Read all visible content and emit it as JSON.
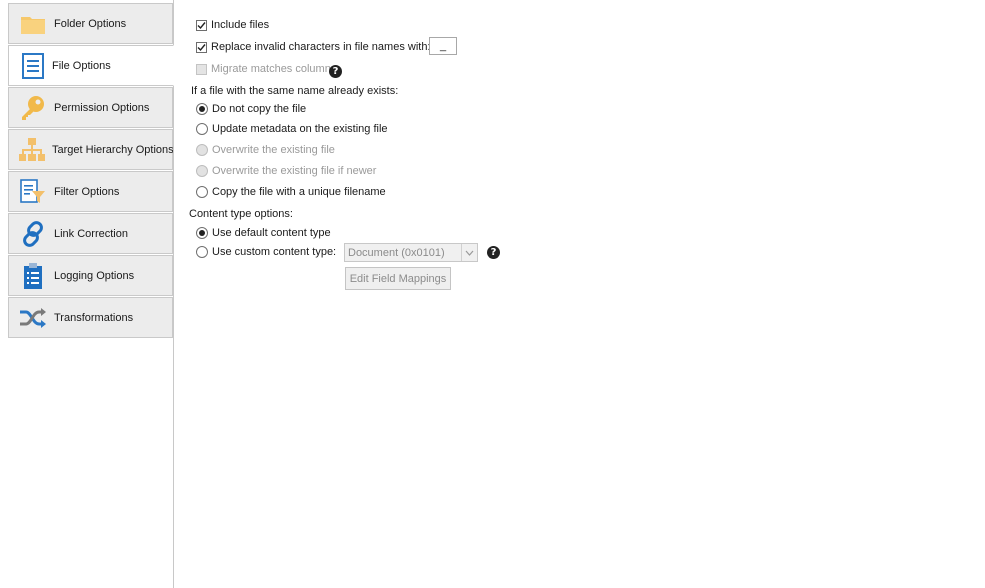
{
  "sidebar": {
    "items": [
      {
        "label": "Folder Options",
        "icon": "folder-icon"
      },
      {
        "label": "File Options",
        "icon": "file-document-icon"
      },
      {
        "label": "Permission Options",
        "icon": "key-icon"
      },
      {
        "label": "Target Hierarchy Options",
        "icon": "hierarchy-icon"
      },
      {
        "label": "Filter Options",
        "icon": "filter-icon"
      },
      {
        "label": "Link Correction",
        "icon": "link-icon"
      },
      {
        "label": "Logging Options",
        "icon": "clipboard-icon"
      },
      {
        "label": "Transformations",
        "icon": "shuffle-icon"
      }
    ],
    "active_index": 1
  },
  "file_options": {
    "include_files": {
      "label": "Include files",
      "checked": true
    },
    "replace_invalid": {
      "label": "Replace invalid characters in file names with:",
      "checked": true,
      "value": "_"
    },
    "migrate_matches": {
      "label": "Migrate matches column",
      "checked": false,
      "enabled": false
    },
    "exists_heading": "If a file with the same name already exists:",
    "exists_options": [
      {
        "label": "Do not copy the file",
        "selected": true,
        "enabled": true
      },
      {
        "label": "Update metadata on the existing file",
        "selected": false,
        "enabled": true
      },
      {
        "label": "Overwrite the existing file",
        "selected": false,
        "enabled": false
      },
      {
        "label": "Overwrite the existing file if newer",
        "selected": false,
        "enabled": false
      },
      {
        "label": "Copy the file with a unique filename",
        "selected": false,
        "enabled": true
      }
    ],
    "content_type_heading": "Content type options:",
    "content_type_options": [
      {
        "label": "Use default content type",
        "selected": true
      },
      {
        "label": "Use custom content type:",
        "selected": false
      }
    ],
    "custom_content_type_value": "Document (0x0101)",
    "edit_field_mappings_label": "Edit Field Mappings",
    "help_glyph": "?"
  }
}
